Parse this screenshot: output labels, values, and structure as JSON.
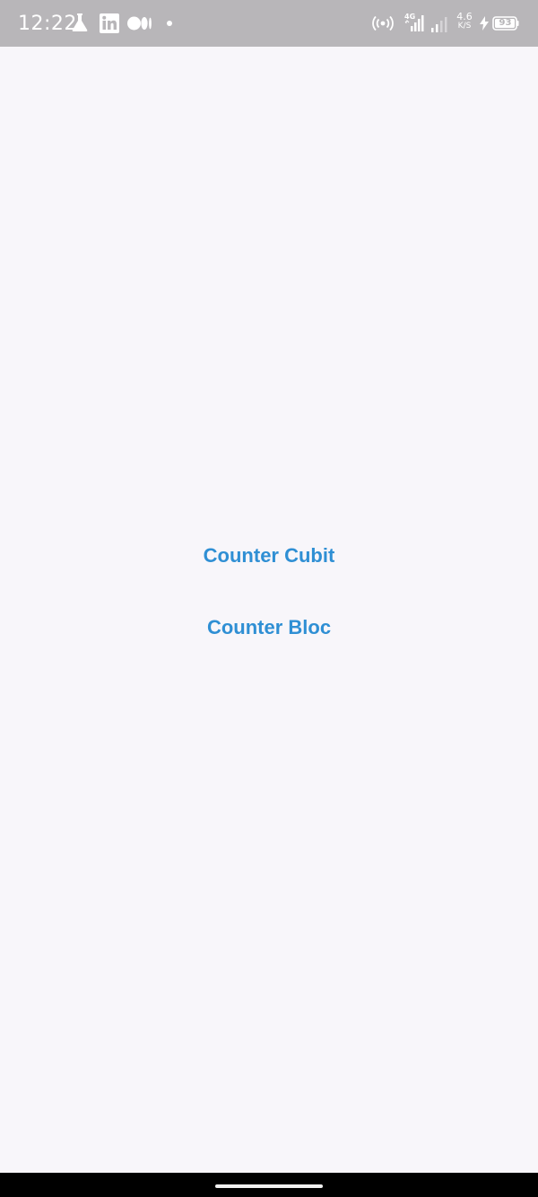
{
  "status_bar": {
    "time": "12:22",
    "network_speed_value": "4.6",
    "network_speed_unit": "K/S",
    "battery_level": "93",
    "network_type": "4G",
    "icons": [
      "labs-flask-icon",
      "linkedin-icon",
      "medium-icon",
      "notification-dot-icon",
      "hotspot-icon",
      "signal-4g-icon",
      "signal-icon",
      "charging-icon",
      "battery-icon"
    ]
  },
  "main": {
    "buttons": [
      {
        "label": "Counter Cubit"
      },
      {
        "label": "Counter Bloc"
      }
    ]
  },
  "colors": {
    "status_bar_bg": "#b8b6b9",
    "page_bg": "#f8f6fa",
    "button_text": "#2f8fd4",
    "nav_bar_bg": "#000000"
  }
}
